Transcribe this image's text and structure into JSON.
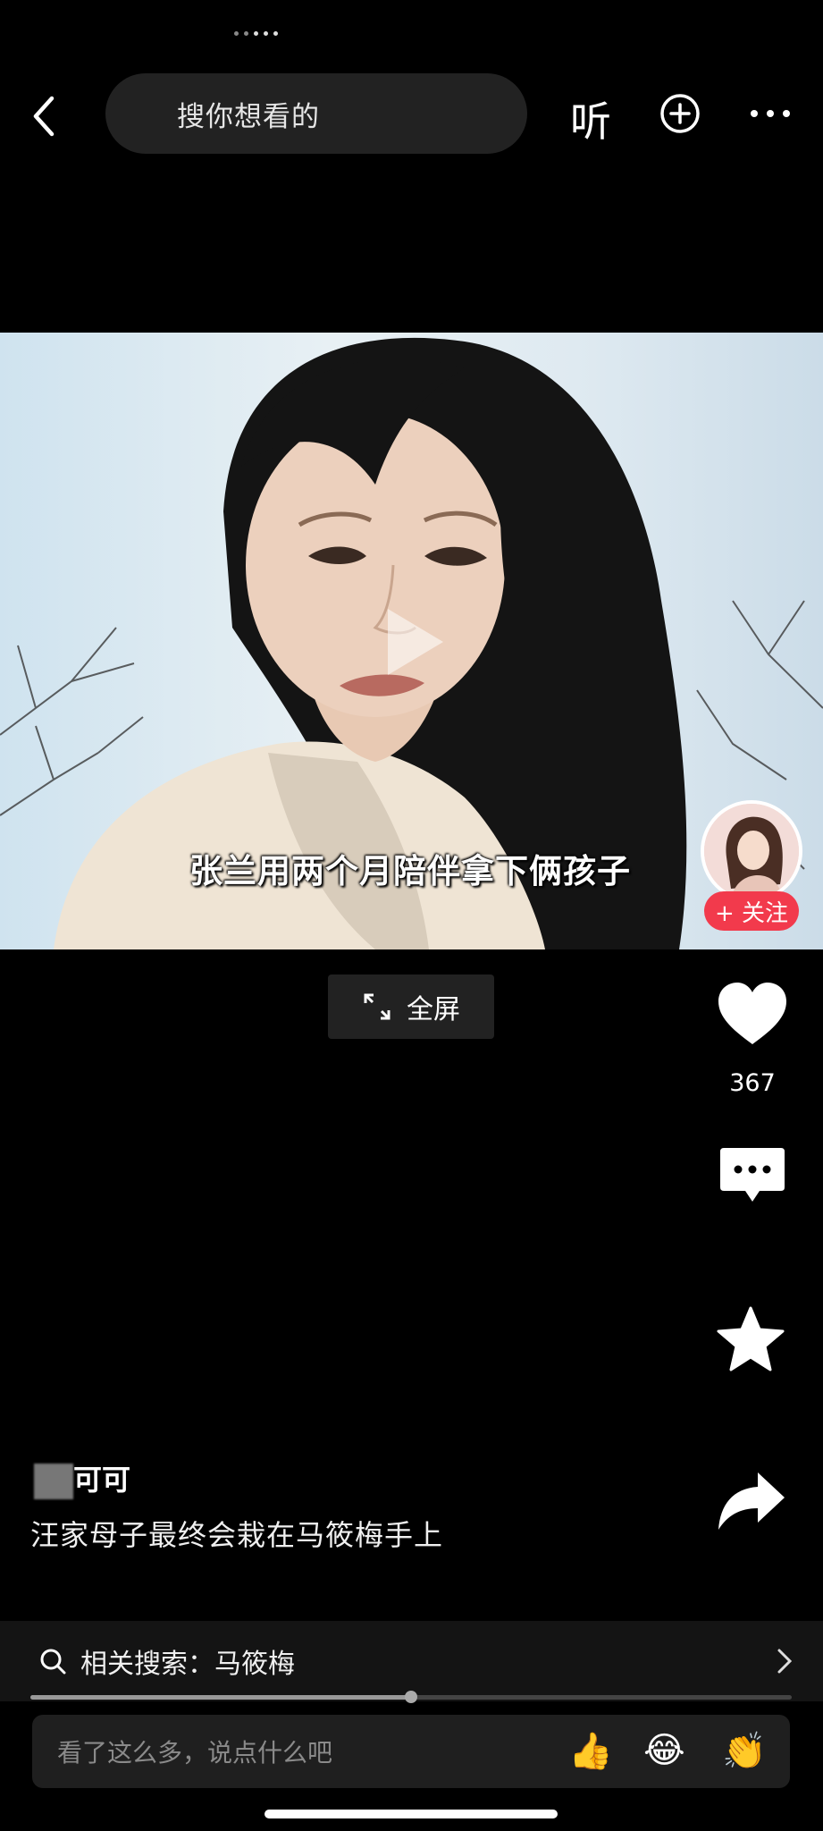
{
  "header": {
    "search_placeholder": "搜你想看的",
    "listen_label": "听"
  },
  "video": {
    "subtitle": "张兰用两个月陪伴拿下俩孩子",
    "fullscreen_label": "全屏"
  },
  "creator": {
    "follow_label": "+ 关注",
    "name": "可可"
  },
  "actions": {
    "like_count": "367"
  },
  "post": {
    "caption": "汪家母子最终会栽在马筱梅手上"
  },
  "related": {
    "label": "相关搜索：马筱梅"
  },
  "playback": {
    "progress_fraction": 0.5
  },
  "comment": {
    "placeholder": "看了这么多，说点什么吧",
    "emojis": [
      "👍",
      "😂",
      "👏"
    ]
  },
  "colors": {
    "follow": "#f23a4c",
    "background": "#000000"
  }
}
